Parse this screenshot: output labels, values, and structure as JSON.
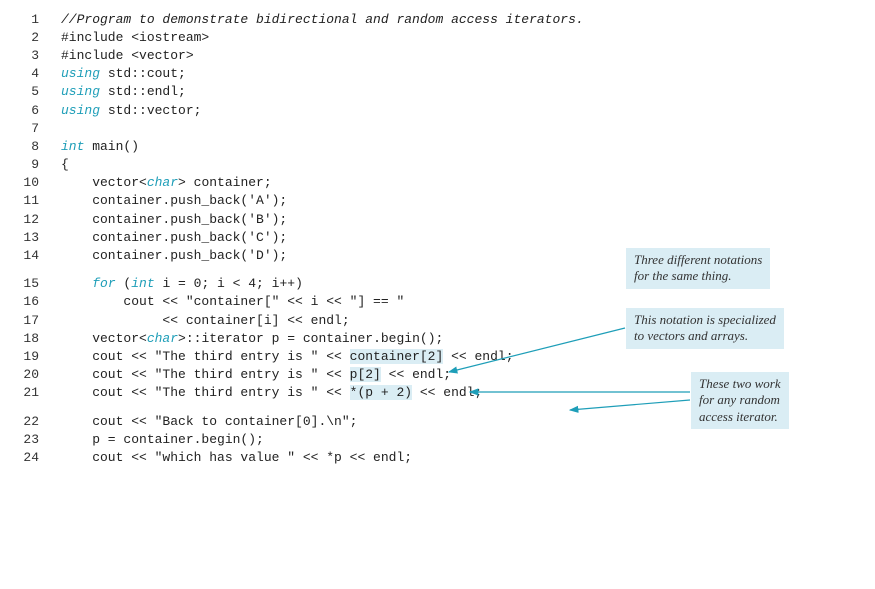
{
  "lines": [
    {
      "n": "1",
      "segs": [
        {
          "c": "comment",
          "t": "//Program to demonstrate bidirectional and random access iterators."
        }
      ]
    },
    {
      "n": "2",
      "segs": [
        {
          "t": "#include <iostream>"
        }
      ]
    },
    {
      "n": "3",
      "segs": [
        {
          "t": "#include <vector>"
        }
      ]
    },
    {
      "n": "4",
      "segs": [
        {
          "c": "keyword",
          "t": "using"
        },
        {
          "t": " std::cout;"
        }
      ]
    },
    {
      "n": "5",
      "segs": [
        {
          "c": "keyword",
          "t": "using"
        },
        {
          "t": " std::endl;"
        }
      ]
    },
    {
      "n": "6",
      "segs": [
        {
          "c": "keyword",
          "t": "using"
        },
        {
          "t": " std::vector;"
        }
      ]
    },
    {
      "n": "7",
      "segs": [
        {
          "t": ""
        }
      ]
    },
    {
      "n": "8",
      "segs": [
        {
          "c": "keyword",
          "t": "int"
        },
        {
          "t": " main()"
        }
      ]
    },
    {
      "n": "9",
      "segs": [
        {
          "t": "{"
        }
      ]
    },
    {
      "n": "10",
      "segs": [
        {
          "t": "    vector<"
        },
        {
          "c": "keyword",
          "t": "char"
        },
        {
          "t": "> container;"
        }
      ]
    },
    {
      "n": "11",
      "segs": [
        {
          "t": "    container.push_back('A');"
        }
      ]
    },
    {
      "n": "12",
      "segs": [
        {
          "t": "    container.push_back('B');"
        }
      ]
    },
    {
      "n": "13",
      "segs": [
        {
          "t": "    container.push_back('C');"
        }
      ]
    },
    {
      "n": "14",
      "segs": [
        {
          "t": "    container.push_back('D');"
        }
      ]
    },
    {
      "n": "15",
      "spacerBefore": true,
      "segs": [
        {
          "t": "    "
        },
        {
          "c": "keyword",
          "t": "for"
        },
        {
          "t": " ("
        },
        {
          "c": "keyword",
          "t": "int"
        },
        {
          "t": " i = 0; i < 4; i++)"
        }
      ]
    },
    {
      "n": "16",
      "segs": [
        {
          "t": "        cout << \"container[\" << i << \"] == \""
        }
      ]
    },
    {
      "n": "17",
      "segs": [
        {
          "t": "             << container[i] << endl;"
        }
      ]
    },
    {
      "n": "18",
      "segs": [
        {
          "t": "    vector<"
        },
        {
          "c": "keyword",
          "t": "char"
        },
        {
          "t": ">::iterator p = container.begin();"
        }
      ]
    },
    {
      "n": "19",
      "segs": [
        {
          "t": "    cout << \"The third entry is \" << "
        },
        {
          "c": "highlight",
          "t": "container[2]"
        },
        {
          "t": " << endl;"
        }
      ]
    },
    {
      "n": "20",
      "segs": [
        {
          "t": "    cout << \"The third entry is \" << "
        },
        {
          "c": "highlight",
          "t": "p[2]"
        },
        {
          "t": " << endl;"
        }
      ]
    },
    {
      "n": "21",
      "segs": [
        {
          "t": "    cout << \"The third entry is \" << "
        },
        {
          "c": "highlight",
          "t": "*(p + 2)"
        },
        {
          "t": " << endl;"
        }
      ]
    },
    {
      "n": "22",
      "spacerBefore": true,
      "segs": [
        {
          "t": "    cout << \"Back to container[0].\\n\";"
        }
      ]
    },
    {
      "n": "23",
      "segs": [
        {
          "t": "    p = container.begin();"
        }
      ]
    },
    {
      "n": "24",
      "segs": [
        {
          "t": "    cout << \"which has value \" << *p << endl;"
        }
      ]
    }
  ],
  "callouts": {
    "c1_l1": "Three different notations",
    "c1_l2": "for the same thing.",
    "c2_l1": "This notation is specialized",
    "c2_l2": "to vectors and arrays.",
    "c3_l1": "These two work",
    "c3_l2": "for any random",
    "c3_l3": "access iterator."
  }
}
